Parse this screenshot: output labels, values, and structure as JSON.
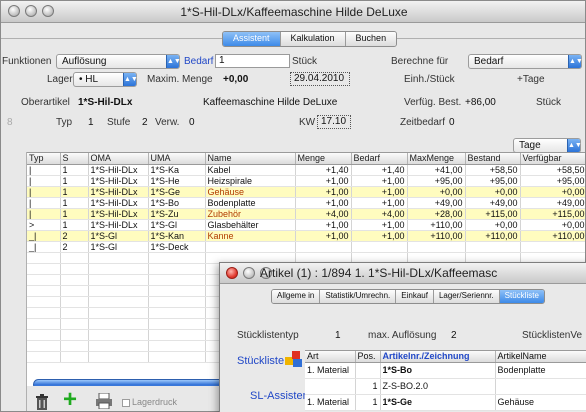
{
  "window": {
    "title": "1*S-Hil-DLx/Kaffeemaschine Hilde DeLuxe"
  },
  "tabs": [
    "Assistent",
    "Kalkulation",
    "Buchen"
  ],
  "form": {
    "funktionen_label": "Funktionen",
    "funktionen_value": "Auflösung",
    "bedarf_label": "Bedarf",
    "bedarf_value": "1",
    "stueck_label": "Stück",
    "berechne_label": "Berechne für",
    "berechne_value": "Bedarf",
    "lager_label": "Lager",
    "lager_value": "• HL",
    "maxmenge_label": "Maxim. Menge",
    "maxmenge_value": "+0,00",
    "date_value": "29.04.2010",
    "einh_label": "Einh./Stück",
    "tage_label": "+Tage",
    "oberartikel_label": "Oberartikel",
    "oberartikel_value": "1*S-Hil-DLx",
    "oberartikel_name": "Kaffeemaschine Hilde DeLuxe",
    "verfueg_label": "Verfüg. Best.",
    "verfueg_value": "+86,00",
    "verfueg_unit": "Stück",
    "typ_label": "Typ",
    "typ_value": "1",
    "stufe_label": "Stufe",
    "stufe_value": "2",
    "verw_label": "Verw.",
    "verw_value": "0",
    "kw_label": "KW",
    "kw_value": "17.10",
    "zeitbedarf_label": "Zeitbedarf",
    "zeitbedarf_value": "0",
    "period_value": "Tage"
  },
  "table": {
    "columns": [
      "Typ",
      "S",
      "OMA",
      "UMA",
      "Name",
      "Menge",
      "Bedarf",
      "MaxMenge",
      "Bestand",
      "Verfügbar"
    ],
    "rows": [
      {
        "typ": "|",
        "s": "1",
        "oma": "1*S-Hil-DLx",
        "uma": "1*S-Ka",
        "name": "Kabel",
        "menge": "+1,40",
        "bedarf": "+1,40",
        "maxmenge": "+41,00",
        "bestand": "+58,50",
        "verf": "+58,50",
        "hl": false
      },
      {
        "typ": "|",
        "s": "1",
        "oma": "1*S-Hil-DLx",
        "uma": "1*S-He",
        "name": "Heizspirale",
        "menge": "+1,00",
        "bedarf": "+1,00",
        "maxmenge": "+95,00",
        "bestand": "+95,00",
        "verf": "+95,00",
        "hl": false
      },
      {
        "typ": "|",
        "s": "1",
        "oma": "1*S-Hil-DLx",
        "uma": "1*S-Ge",
        "name": "Gehäuse",
        "menge": "+1,00",
        "bedarf": "+1,00",
        "maxmenge": "+0,00",
        "bestand": "+0,00",
        "verf": "+0,00",
        "hl": true
      },
      {
        "typ": "|",
        "s": "1",
        "oma": "1*S-Hil-DLx",
        "uma": "1*S-Bo",
        "name": "Bodenplatte",
        "menge": "+1,00",
        "bedarf": "+1,00",
        "maxmenge": "+49,00",
        "bestand": "+49,00",
        "verf": "+49,00",
        "hl": false
      },
      {
        "typ": "|",
        "s": "1",
        "oma": "1*S-Hil-DLx",
        "uma": "1*S-Zu",
        "name": "Zubehör",
        "menge": "+4,00",
        "bedarf": "+4,00",
        "maxmenge": "+28,00",
        "bestand": "+115,00",
        "verf": "+115,00",
        "hl": true
      },
      {
        "typ": ">",
        "s": "1",
        "oma": "1*S-Hil-DLx",
        "uma": "1*S-Gl",
        "name": "Glasbehälter",
        "menge": "+1,00",
        "bedarf": "+1,00",
        "maxmenge": "+110,00",
        "bestand": "+0,00",
        "verf": "+0,00",
        "hl": false
      },
      {
        "typ": "_|",
        "s": "2",
        "oma": "1*S-Gl",
        "uma": "1*S-Kan",
        "name": "Kanne",
        "menge": "+1,00",
        "bedarf": "+1,00",
        "maxmenge": "+110,00",
        "bestand": "+110,00",
        "verf": "+110,00",
        "hl": true
      },
      {
        "typ": "_|",
        "s": "2",
        "oma": "1*S-Gl",
        "uma": "1*S-Deck",
        "name": "",
        "menge": "",
        "bedarf": "",
        "maxmenge": "",
        "bestand": "",
        "verf": "",
        "hl": false
      }
    ]
  },
  "bottom": {
    "lagerdruck_label": "Lagerdruck"
  },
  "window2": {
    "title": "Artikel (1) : 1/894  1.  1*S-Hil-DLx/Kaffeemasc",
    "tabs": [
      "Allgeme in",
      "Statistik/Umrechn.",
      "Einkauf",
      "Lager/Seriennr.",
      "Stückliste"
    ],
    "stl_typ_label": "Stücklistentyp",
    "stl_typ_value": "1",
    "max_aufl_label": "max. Auflösung",
    "max_aufl_value": "2",
    "stl_ver_label": "StücklistenVe",
    "stueckliste_link": "Stückliste",
    "sl_assistent_link": "SL-Assistent",
    "columns": [
      "Art",
      "Pos.",
      "Artikelnr./Zeichnung",
      "ArtikelName"
    ],
    "rows": [
      {
        "art": "1. Material",
        "pos": "",
        "artnr": "1*S-Bo",
        "name": "Bodenplatte"
      },
      {
        "art": "",
        "pos": "1",
        "artnr": "Z-S-BO.2.0",
        "name": ""
      },
      {
        "art": "1. Material",
        "pos": "1",
        "artnr": "1*S-Ge",
        "name": "Gehäuse"
      }
    ]
  },
  "colors": {
    "accent": "#3d8ae8",
    "highlight_row": "#fffcbf",
    "highlight_text": "#b23c00",
    "link": "#2148c7",
    "add_green": "#1faa1f"
  }
}
